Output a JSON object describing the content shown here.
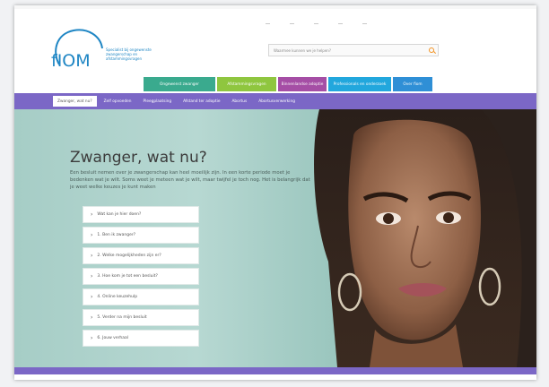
{
  "header": {
    "logo_text": "fIOM",
    "tagline": "Specialist bij ongewenste zwangerschap en afstammingsvragen",
    "search_placeholder": "Waarmee kunnen we je helpen?"
  },
  "category_tabs": [
    {
      "label": "Ongewenst zwanger",
      "color": "#3aaa8e"
    },
    {
      "label": "Afstammingsvragen",
      "color": "#8fc63f"
    },
    {
      "label": "Binnenlandse adoptie",
      "color": "#a54ea5"
    },
    {
      "label": "Professionals en onderzoek",
      "color": "#22a7dd"
    },
    {
      "label": "Over fiom",
      "color": "#2f8fd6"
    }
  ],
  "nav": {
    "items": [
      {
        "label": "Zwanger, wat nu?",
        "active": true
      },
      {
        "label": "Zelf opvoeden",
        "active": false
      },
      {
        "label": "Pleegplaatsing",
        "active": false
      },
      {
        "label": "Afstand ter adoptie",
        "active": false
      },
      {
        "label": "Abortus",
        "active": false
      },
      {
        "label": "Abortusverwerking",
        "active": false
      }
    ]
  },
  "hero": {
    "title": "Zwanger, wat nu?",
    "intro": "Een besluit nemen over je zwangerschap kan heel moeilijk zijn. In een korte periode moet je bedenken wat je wilt. Soms weet je meteen wat je wilt, maar twijfel je toch nog. Het is belangrijk dat je weet welke keuzes je kunt maken",
    "questions": [
      "Wat kan je hier doen?",
      "1. Ben ik zwanger?",
      "2. Welke mogelijkheden zijn er?",
      "3. Hoe kom je tot een besluit?",
      "4. Online keuzehulp",
      "5. Verder na mijn besluit",
      "6. Jouw verhaal"
    ]
  },
  "colors": {
    "brand_purple": "#7b67c6",
    "brand_blue": "#1f86c4",
    "search_accent": "#f29222"
  }
}
